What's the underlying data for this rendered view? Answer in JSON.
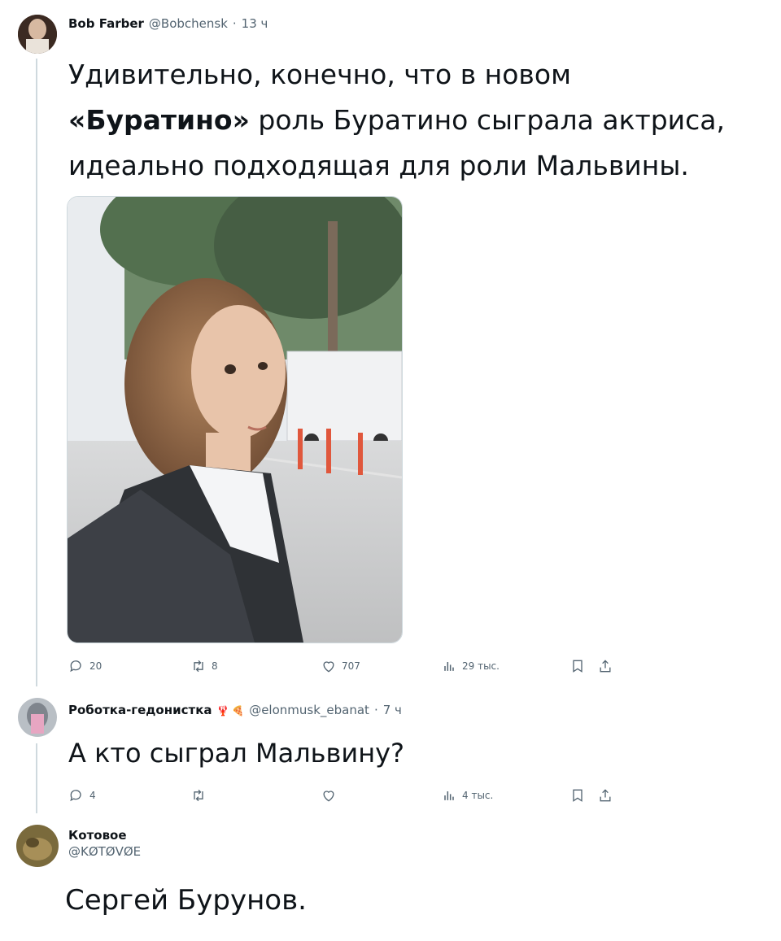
{
  "tweets": [
    {
      "author_name": "Bob Farber",
      "handle": "@Bobchensk",
      "time": "13 ч",
      "text_line1": "Удивительно, конечно, что в новом",
      "text_line2_bold": "«Буратино»",
      "text_line2_rest": " роль Буратино сыграла актриса,",
      "text_line3": "идеально подходящая для роли Мальвины.",
      "stats": {
        "replies": "20",
        "reposts": "8",
        "likes": "707",
        "views": "29 тыс."
      }
    },
    {
      "author_name": "Роботка-гедонистка",
      "emoji": "🦞 🍕",
      "handle": "@elonmusk_ebanat",
      "time": "7 ч",
      "text": "А кто сыграл Мальвину?",
      "stats": {
        "replies": "4",
        "views": "4 тыс."
      }
    },
    {
      "author_name": "Котовое",
      "handle": "@KØTØVØE",
      "text": "Сергей Бурунов."
    }
  ]
}
